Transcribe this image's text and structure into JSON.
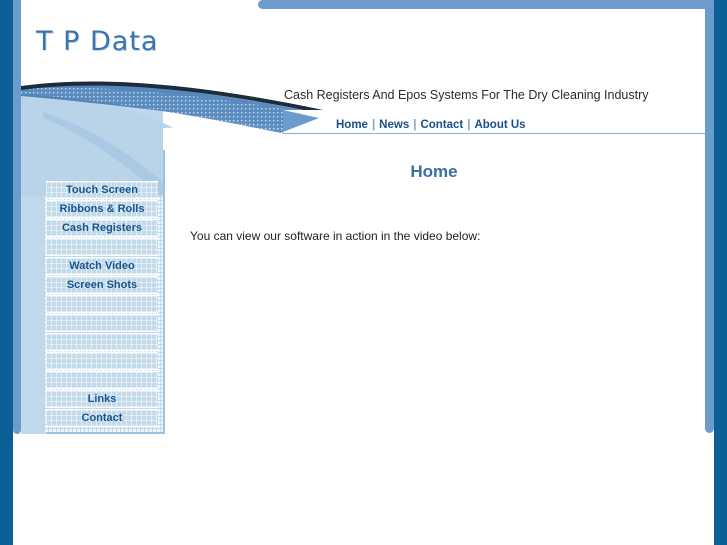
{
  "site": {
    "logo": "T P Data",
    "tagline": "Cash Registers And Epos Systems For The Dry Cleaning Industry"
  },
  "topnav": {
    "separator": "|",
    "items": [
      {
        "label": "Home"
      },
      {
        "label": "News"
      },
      {
        "label": "Contact"
      },
      {
        "label": "About Us"
      }
    ]
  },
  "sidebar": {
    "items": [
      {
        "label": "Touch Screen",
        "blank": false
      },
      {
        "label": "Ribbons & Rolls",
        "blank": false
      },
      {
        "label": "Cash Registers",
        "blank": false
      },
      {
        "label": "",
        "blank": true
      },
      {
        "label": "Watch Video",
        "blank": false
      },
      {
        "label": "Screen Shots",
        "blank": false
      },
      {
        "label": "",
        "blank": true
      },
      {
        "label": "",
        "blank": true
      },
      {
        "label": "",
        "blank": true
      },
      {
        "label": "",
        "blank": true
      },
      {
        "label": "",
        "blank": true
      },
      {
        "label": "Links",
        "blank": false
      },
      {
        "label": "Contact",
        "blank": false
      }
    ]
  },
  "main": {
    "title": "Home",
    "paragraph": "You can view our software in action in the video below:"
  },
  "colors": {
    "frame_dark_blue": "#0c6095",
    "frame_mid_blue": "#6c9bcd",
    "logo_blue": "#3a74ab",
    "nav_link_blue": "#1b4f86",
    "title_blue": "#3a6ea5",
    "sidebar_button_blue": "#c3daeb",
    "sidebar_text_blue": "#18558e",
    "light_panel_blue": "#c0d8ec",
    "body_text": "#1f1f1f"
  }
}
